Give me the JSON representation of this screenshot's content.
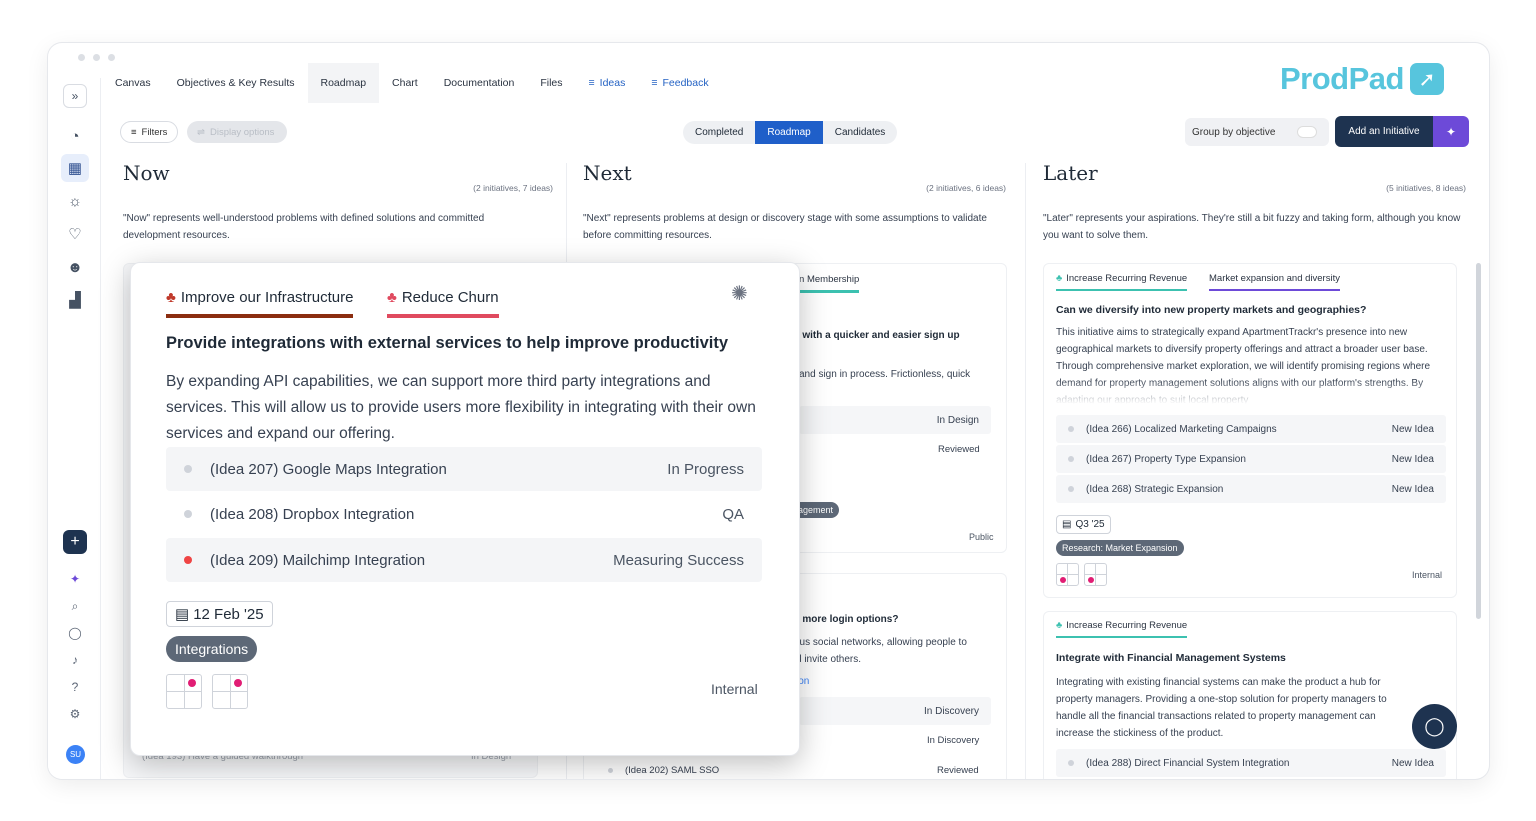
{
  "app": {
    "logo_text": "ProdPad",
    "logo_icon": "prodpad-arrow-icon",
    "avatar_initials": "SU"
  },
  "colors": {
    "accent": "#1f5fc9",
    "navy": "#1e3350",
    "purple": "#6d4ad8",
    "logo": "#57c5dd",
    "infra": "#8b2d10",
    "churn": "#e04a5f",
    "teal": "#3cc1b0"
  },
  "nav": {
    "tabs": [
      "Canvas",
      "Objectives & Key Results",
      "Roadmap",
      "Chart",
      "Documentation",
      "Files",
      "Ideas",
      "Feedback"
    ]
  },
  "toolbar": {
    "filters": "Filters",
    "display_options": "Display options",
    "segments": [
      "Completed",
      "Roadmap",
      "Candidates"
    ],
    "group_by": "Group by objective",
    "add_initiative": "Add an Initiative"
  },
  "columns": {
    "now": {
      "title": "Now",
      "count": "(2 initiatives, 7 ideas)",
      "desc": "\"Now\" represents well-understood problems with defined solutions and committed development resources."
    },
    "next": {
      "title": "Next",
      "count": "(2 initiatives, 6 ideas)",
      "desc": "\"Next\" represents problems at design or discovery stage with some assumptions to validate before committing resources."
    },
    "later": {
      "title": "Later",
      "count": "(5 initiatives, 8 ideas)",
      "desc": "\"Later\" represents your aspirations. They're still a bit fuzzy and taking form, although you know you want to solve them."
    }
  },
  "popup": {
    "objectives": [
      "Improve our Infrastructure",
      "Reduce Churn"
    ],
    "title": "Provide integrations with external services to help improve productivity",
    "body": "By expanding API capabilities, we can support more third party integrations and services. This will allow us to provide users more flexibility in integrating with their own services and expand our offering.",
    "ideas": [
      {
        "ref": "(Idea 207)",
        "name": "Google Maps Integration",
        "status": "In Progress"
      },
      {
        "ref": "(Idea 208)",
        "name": "Dropbox Integration",
        "status": "QA"
      },
      {
        "ref": "(Idea 209)",
        "name": "Mailchimp Integration",
        "status": "Measuring Success"
      }
    ],
    "date": "12 Feb '25",
    "tag": "Integrations",
    "visibility": "Internal"
  },
  "next_cards": {
    "card1": {
      "objective": "tion Membership",
      "title": "s with a quicker and easier sign up",
      "body": "and sign in process. Frictionless, quick",
      "status1": "In Design",
      "status2": "Reviewed",
      "tag": "agement",
      "visibility": "Public"
    },
    "card2": {
      "title": "s more login options?",
      "body1": "ous social networks, allowing people to",
      "body2": "d invite others.",
      "link": "ion",
      "status1": "In Discovery",
      "status2": "In Discovery",
      "idea_ref": "(Idea 202)",
      "idea_name": "SAML SSO",
      "status3": "Reviewed"
    }
  },
  "now_ghost": {
    "idea": "(Idea 193) Have a guided walkthrough",
    "status": "In Design"
  },
  "later_cards": {
    "card1": {
      "objectives": [
        "Increase Recurring Revenue",
        "Market expansion and diversity"
      ],
      "title": "Can we diversify into new property markets and geographies?",
      "body": "This initiative aims to strategically expand ApartmentTrackr's presence into new geographical markets to diversify property offerings and attract a broader user base. Through comprehensive market exploration, we will identify promising regions where demand for property management solutions aligns with our platform's strengths. By adapting our approach to suit local property",
      "ideas": [
        {
          "ref": "(Idea 266)",
          "name": "Localized Marketing Campaigns",
          "status": "New Idea"
        },
        {
          "ref": "(Idea 267)",
          "name": "Property Type Expansion",
          "status": "New Idea"
        },
        {
          "ref": "(Idea 268)",
          "name": "Strategic Expansion",
          "status": "New Idea"
        }
      ],
      "date": "Q3 '25",
      "tag": "Research: Market Expansion",
      "visibility": "Internal"
    },
    "card2": {
      "objective": "Increase Recurring Revenue",
      "title": "Integrate with Financial Management Systems",
      "body": "Integrating with existing financial systems can make the product a hub for property managers. Providing a one-stop solution for property managers to handle all the financial transactions related to property management can increase the stickiness of the product.",
      "idea": {
        "ref": "(Idea 288)",
        "name": "Direct Financial System Integration",
        "status": "New Idea"
      }
    }
  }
}
